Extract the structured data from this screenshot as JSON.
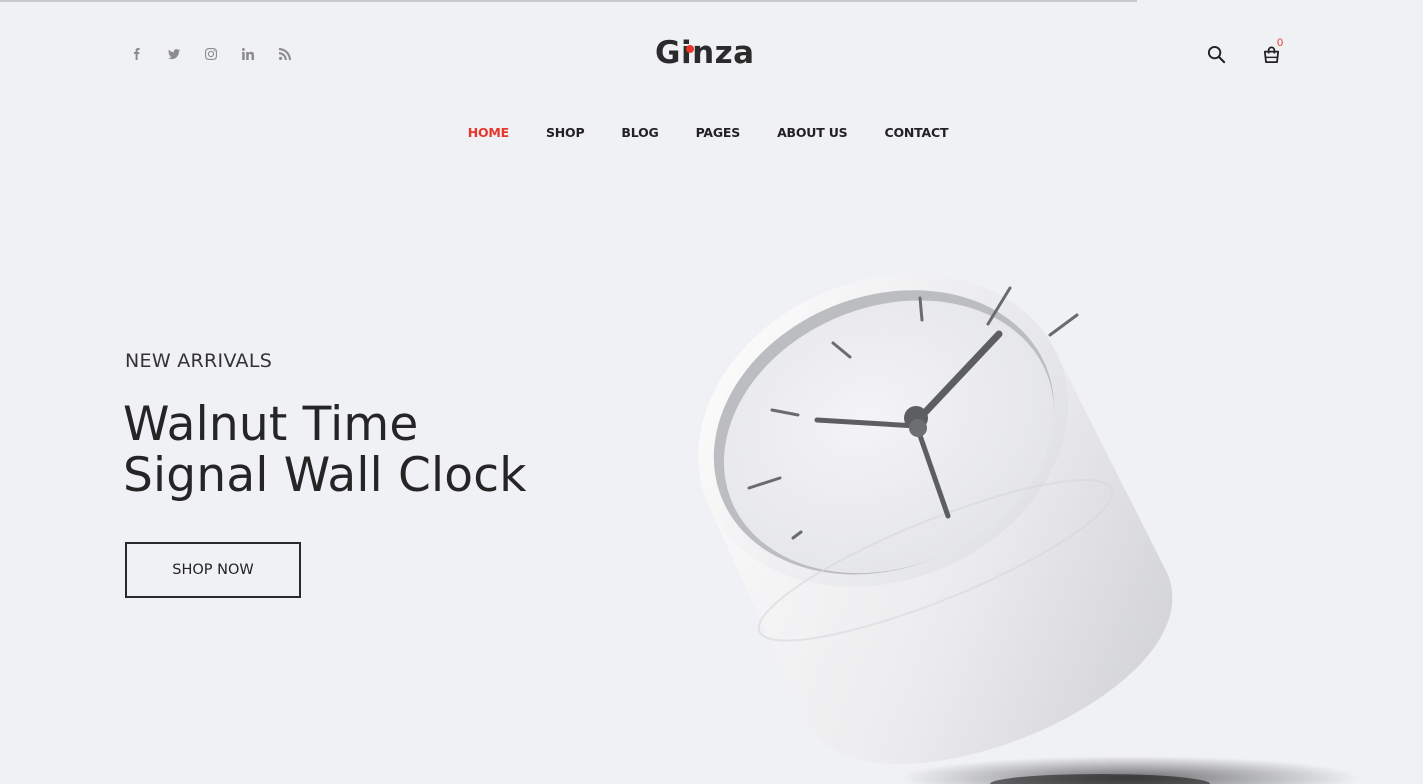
{
  "brand": {
    "name": "Ginza",
    "accent": "#e5372b"
  },
  "social": [
    {
      "icon": "facebook-icon"
    },
    {
      "icon": "twitter-icon"
    },
    {
      "icon": "instagram-icon"
    },
    {
      "icon": "linkedin-icon"
    },
    {
      "icon": "rss-icon"
    }
  ],
  "header": {
    "search_icon": "search-icon",
    "cart_icon": "shopping-bag-icon",
    "cart_count": "0"
  },
  "nav": {
    "items": [
      {
        "label": "HOME",
        "active": true
      },
      {
        "label": "SHOP",
        "active": false
      },
      {
        "label": "BLOG",
        "active": false
      },
      {
        "label": "PAGES",
        "active": false
      },
      {
        "label": "ABOUT US",
        "active": false
      },
      {
        "label": "CONTACT",
        "active": false
      }
    ]
  },
  "hero": {
    "eyebrow": "NEW ARRIVALS",
    "title_line1": "Walnut Time",
    "title_line2": "Signal Wall Clock",
    "cta_label": "SHOP NOW",
    "image": "white-desk-clock-image"
  }
}
